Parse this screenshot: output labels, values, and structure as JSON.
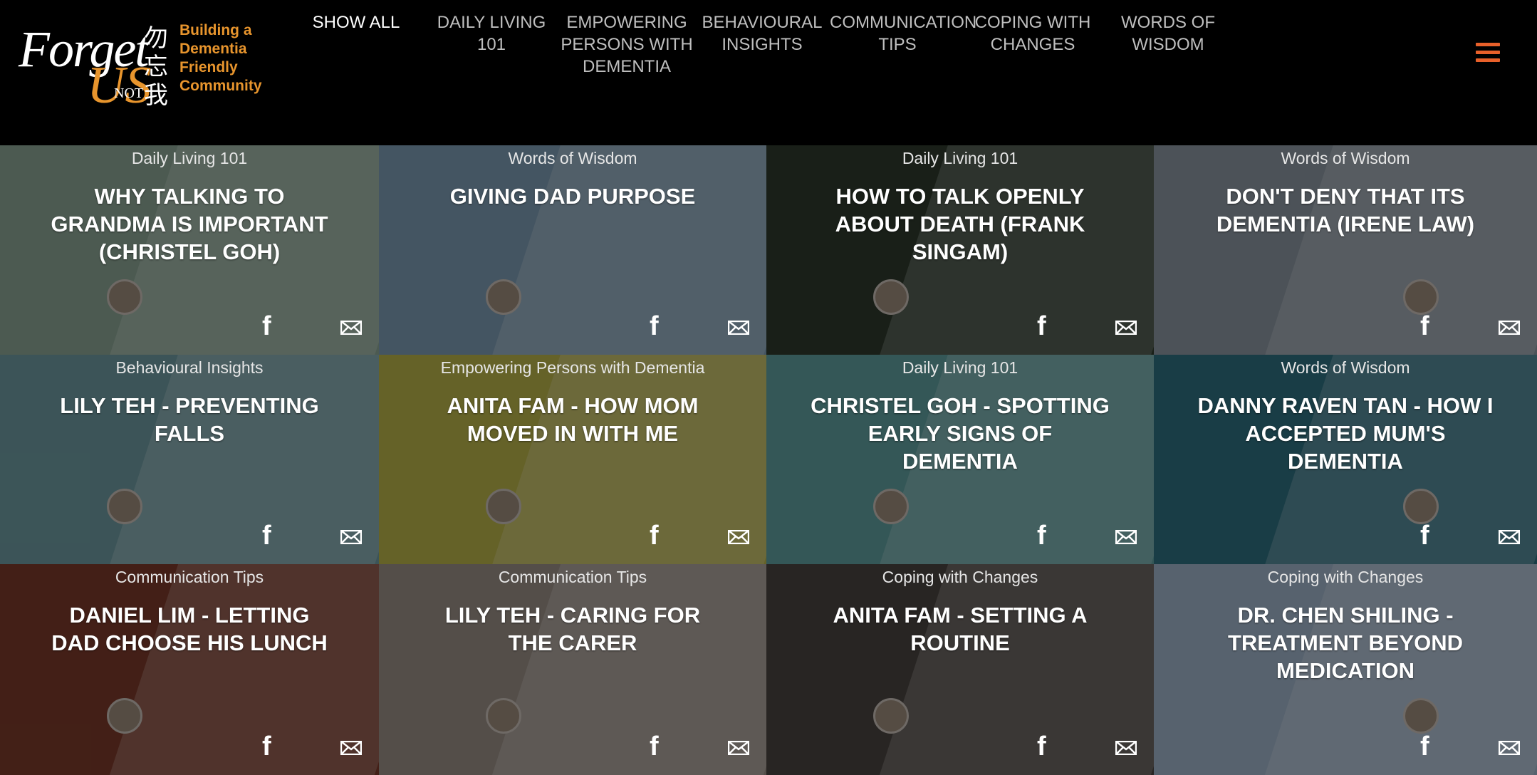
{
  "header": {
    "logo": {
      "forget": "Forget",
      "us": "US",
      "not": "NOT",
      "cjk": "勿忘我"
    },
    "tagline": [
      "Building a",
      "Dementia",
      "Friendly",
      "Community"
    ],
    "nav": [
      {
        "label": "SHOW ALL"
      },
      {
        "label": "DAILY LIVING 101"
      },
      {
        "label": "EMPOWERING PERSONS WITH DEMENTIA"
      },
      {
        "label": "BEHAVIOURAL INSIGHTS"
      },
      {
        "label": "COMMUNICATION TIPS"
      },
      {
        "label": "COPING WITH CHANGES"
      },
      {
        "label": "WORDS OF WISDOM"
      }
    ]
  },
  "cards": [
    {
      "category": "Daily Living 101",
      "title": "WHY TALKING TO GRANDMA IS IMPORTANT (CHRISTEL GOH)"
    },
    {
      "category": "Words of Wisdom",
      "title": "GIVING DAD PURPOSE"
    },
    {
      "category": "Daily Living 101",
      "title": "HOW TO TALK OPENLY ABOUT DEATH (FRANK SINGAM)"
    },
    {
      "category": "Words of Wisdom",
      "title": "DON'T DENY THAT ITS DEMENTIA (IRENE LAW)"
    },
    {
      "category": "Behavioural Insights",
      "title": "LILY TEH - PREVENTING FALLS"
    },
    {
      "category": "Empowering Persons with Dementia",
      "title": "ANITA FAM - HOW MOM MOVED IN WITH ME"
    },
    {
      "category": "Daily Living 101",
      "title": "CHRISTEL GOH - SPOTTING EARLY SIGNS OF DEMENTIA"
    },
    {
      "category": "Words of Wisdom",
      "title": "DANNY RAVEN TAN - HOW I ACCEPTED MUM'S DEMENTIA"
    },
    {
      "category": "Communication Tips",
      "title": "DANIEL LIM - LETTING DAD CHOOSE HIS LUNCH"
    },
    {
      "category": "Communication Tips",
      "title": "LILY TEH - CARING FOR THE CARER"
    },
    {
      "category": "Coping with Changes",
      "title": "ANITA FAM - SETTING A ROUTINE"
    },
    {
      "category": "Coping with Changes",
      "title": "DR. CHEN SHILING - TREATMENT BEYOND MEDICATION"
    }
  ],
  "share": {
    "facebook_glyph": "f"
  },
  "colors": {
    "accent": "#e8952d",
    "menu": "#e8602a",
    "card_bgs": [
      "#8aa594",
      "#7d9bb3",
      "#2e3a2c",
      "#8a95a0",
      "#6d9aa0",
      "#b9b24a",
      "#5f9e9e",
      "#2f6f80",
      "#7a3a2a",
      "#9a8f86",
      "#4a4440",
      "#9fb3c8"
    ]
  }
}
